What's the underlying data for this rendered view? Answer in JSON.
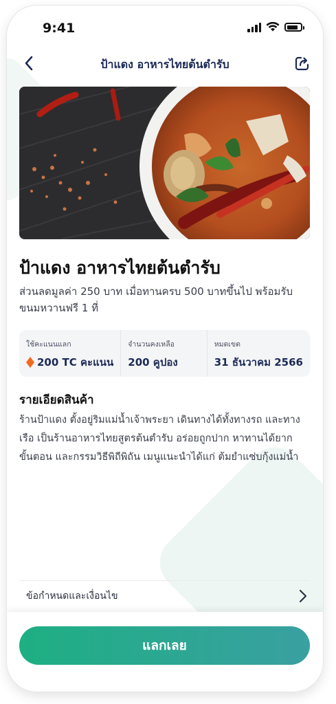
{
  "status_bar": {
    "time": "9:41"
  },
  "nav": {
    "title": "ป้าแดง อาหารไทยต้นตำรับ"
  },
  "product": {
    "title": "ป้าแดง อาหารไทยต้นตำรับ",
    "subtitle": "ส่วนลดมูลค่า 250 บาท เมื่อทานครบ 500 บาทขึ้นไป พร้อมรับขนมหวานฟรี 1 ที่"
  },
  "info": {
    "points_label": "ใช้คะแนนแลก",
    "points_value": "200 TC คะแนน",
    "remaining_label": "จำนวนคงเหลือ",
    "remaining_value": "200 คูปอง",
    "expiry_label": "หมดเขต",
    "expiry_value": "31 ธันวาคม 2566"
  },
  "details": {
    "title": "รายเอียดสินค้า",
    "body": "ร้านป้าแดง ตั้งอยู่ริมแม่น้ำเจ้าพระยา เดินทางได้ทั้งทางรถ และทางเรือ เป็นร้านอาหารไทยสูตรต้นตำรับ อร่อยถูกปาก หาทานได้ยาก ขั้นตอน และกรรมวิธีพิถีพิถัน เมนูแนะนำได้แก่ ต้มยำแซ่บกุ้งแม่น้ำ"
  },
  "terms": {
    "label": "ข้อกำหนดและเงื่อนไข"
  },
  "footer": {
    "redeem_label": "แลกเลย"
  },
  "colors": {
    "accent_start": "#1eaf83",
    "accent_end": "#3aa0a1",
    "navy": "#1c2a56",
    "points_icon": "#f26a21"
  }
}
